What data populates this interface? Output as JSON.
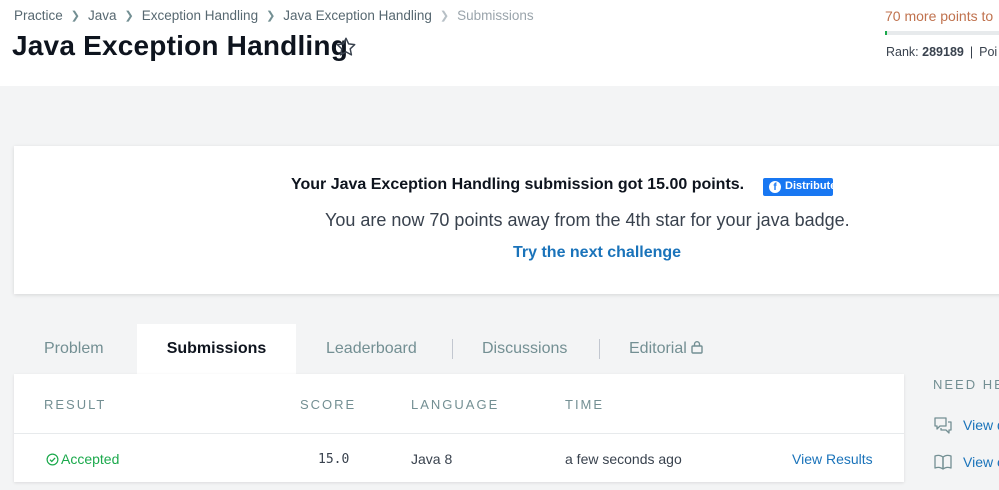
{
  "breadcrumb": [
    "Practice",
    "Java",
    "Exception Handling",
    "Java Exception Handling",
    "Submissions"
  ],
  "title": "Java Exception Handling",
  "progress": {
    "text": "70 more points to",
    "fraction": 0.02,
    "rank_label": "Rank:",
    "rank_value": "289189",
    "points_label": "Poi"
  },
  "banner": {
    "message": "Your Java Exception Handling submission got 15.00 points.",
    "share_label": "Distribute",
    "sub_message": "You are now 70 points away from the 4th star for your java badge.",
    "next_link": "Try the next challenge"
  },
  "tabs": [
    {
      "label": "Problem",
      "active": false
    },
    {
      "label": "Submissions",
      "active": true
    },
    {
      "label": "Leaderboard",
      "active": false
    },
    {
      "label": "Discussions",
      "active": false
    },
    {
      "label": "Editorial",
      "active": false,
      "locked": true
    }
  ],
  "table": {
    "headers": [
      "RESULT",
      "SCORE",
      "LANGUAGE",
      "TIME"
    ],
    "rows": [
      {
        "result": "Accepted",
        "score": "15.0",
        "language": "Java 8",
        "time": "a few seconds ago",
        "action": "View Results"
      }
    ]
  },
  "help": {
    "title": "NEED HE",
    "items": [
      "View d",
      "View e"
    ]
  },
  "colors": {
    "accepted": "#1ba94c",
    "link": "#1a73ba",
    "progress_text": "#c0724e",
    "facebook": "#1877f2"
  }
}
